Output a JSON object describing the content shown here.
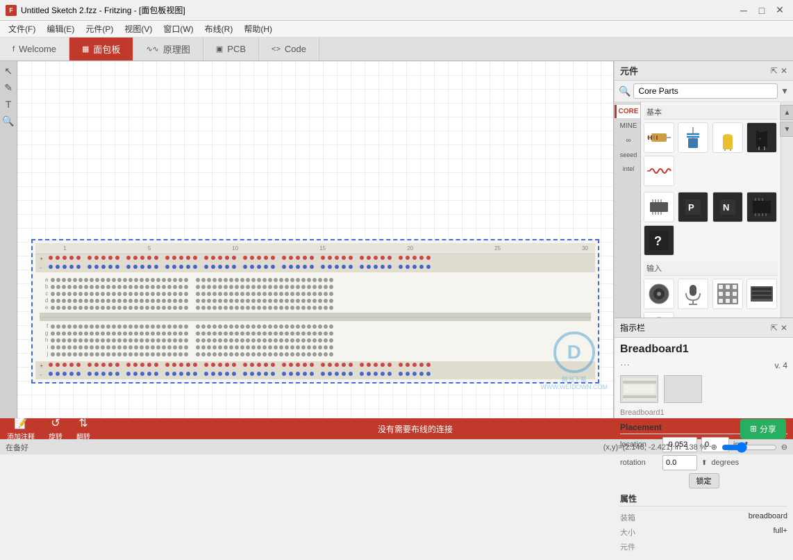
{
  "titlebar": {
    "icon": "F",
    "title": "Untitled Sketch 2.fzz - Fritzing - [面包板视图]",
    "minimize": "─",
    "maximize": "□",
    "close": "✕"
  },
  "menubar": {
    "items": [
      {
        "label": "文件(F)"
      },
      {
        "label": "编辑(E)"
      },
      {
        "label": "元件(P)"
      },
      {
        "label": "视图(V)"
      },
      {
        "label": "窗口(W)"
      },
      {
        "label": "布线(R)"
      },
      {
        "label": "帮助(H)"
      }
    ]
  },
  "tabs": [
    {
      "label": "Welcome",
      "icon": "f",
      "active": false
    },
    {
      "label": "面包板",
      "icon": "▦",
      "active": true
    },
    {
      "label": "原理图",
      "icon": "∿∿",
      "active": false
    },
    {
      "label": "PCB",
      "icon": "▣",
      "active": false
    },
    {
      "label": "Code",
      "icon": "<>",
      "active": false
    }
  ],
  "canvas": {
    "status": "在备好"
  },
  "parts_panel": {
    "title": "元件",
    "search_placeholder": "Core Parts",
    "section_base_label": "基本",
    "section_input_label": "输入",
    "tabs": [
      "CORE",
      "MINE",
      "∞",
      "🌱",
      "intel"
    ],
    "scroll_up": "▲",
    "scroll_down": "▼"
  },
  "inspector": {
    "title": "指示栏",
    "component_name": "Breadboard1",
    "dots": "···",
    "version_label": "v. 4",
    "component_label": "Breadboard1",
    "placement_section": "Placement",
    "location_label": "location",
    "location_x": "-0.052",
    "location_y": "0.",
    "location_unit": "in",
    "rotation_label": "rotation",
    "rotation_val": "0.0",
    "rotation_unit": "degrees",
    "lock_btn": "锁定",
    "properties_section": "属性",
    "props": [
      {
        "key": "装箱",
        "val": "breadboard"
      },
      {
        "key": "大小",
        "val": "full+"
      },
      {
        "key": "元件",
        "val": ""
      }
    ]
  },
  "statusbar": {
    "add_comment_label": "添加注释",
    "rotate_label": "旋转",
    "flip_label": "翻转",
    "center_text": "没有需要布线的连接",
    "share_label": "分享",
    "share_icon": "⊞"
  },
  "infobar": {
    "status": "在备好",
    "coords": "(x,y)=(2.148, -2.421) in",
    "zoom": "138 %",
    "zoom_icon": "⊕",
    "zoom_icon2": "⊖"
  },
  "parts_grid": {
    "base_items": [
      {
        "icon": "🔴🔴🔴🔴",
        "color": "normal",
        "type": "resistor"
      },
      {
        "icon": "💧",
        "color": "normal",
        "type": "capacitor"
      },
      {
        "icon": "🔶",
        "color": "normal",
        "type": "led"
      },
      {
        "icon": "⬛",
        "color": "normal",
        "type": "electrolytic"
      },
      {
        "icon": "🌀",
        "color": "normal",
        "type": "coil"
      }
    ],
    "input_items": [
      {
        "icon": "■",
        "color": "normal",
        "type": "switch"
      },
      {
        "icon": "P",
        "color": "dark",
        "type": "pnp"
      },
      {
        "icon": "N",
        "color": "dark",
        "type": "npn"
      },
      {
        "icon": "▬▬",
        "color": "dark",
        "type": "ic"
      },
      {
        "icon": "?",
        "color": "dark",
        "type": "unknown"
      }
    ]
  }
}
